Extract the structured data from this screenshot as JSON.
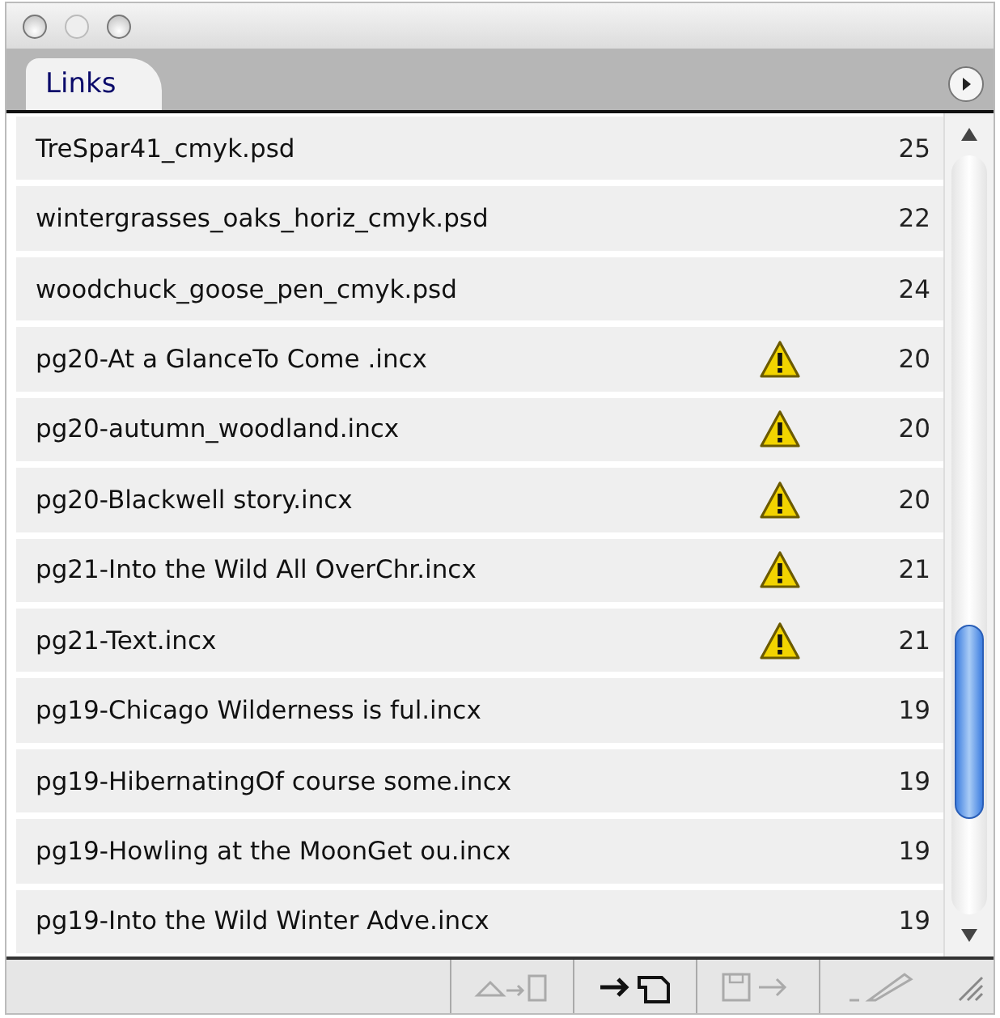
{
  "tabs": [
    {
      "label": "Links",
      "selected": true
    }
  ],
  "links": [
    {
      "name": "TreSpar41_cmyk.psd",
      "warning": false,
      "page": "25"
    },
    {
      "name": "wintergrasses_oaks_horiz_cmyk.psd",
      "warning": false,
      "page": "22"
    },
    {
      "name": "woodchuck_goose_pen_cmyk.psd",
      "warning": false,
      "page": "24"
    },
    {
      "name": "pg20-At a GlanceTo Come .incx",
      "warning": true,
      "page": "20"
    },
    {
      "name": "pg20-autumn_woodland.incx",
      "warning": true,
      "page": "20"
    },
    {
      "name": "pg20-Blackwell story.incx",
      "warning": true,
      "page": "20"
    },
    {
      "name": "pg21-Into the Wild All OverChr.incx",
      "warning": true,
      "page": "21"
    },
    {
      "name": "pg21-Text.incx",
      "warning": true,
      "page": "21"
    },
    {
      "name": "pg19-Chicago Wilderness is ful.incx",
      "warning": false,
      "page": "19"
    },
    {
      "name": "pg19-HibernatingOf course some.incx",
      "warning": false,
      "page": "19"
    },
    {
      "name": "pg19-Howling at the MoonGet ou.incx",
      "warning": false,
      "page": "19"
    },
    {
      "name": "pg19-Into the Wild Winter Adve.incx",
      "warning": false,
      "page": "19"
    }
  ],
  "toolbar": [
    {
      "kind": "relink",
      "disabled": true
    },
    {
      "kind": "goto",
      "disabled": false
    },
    {
      "kind": "update",
      "disabled": true
    },
    {
      "kind": "edit",
      "disabled": true
    }
  ]
}
